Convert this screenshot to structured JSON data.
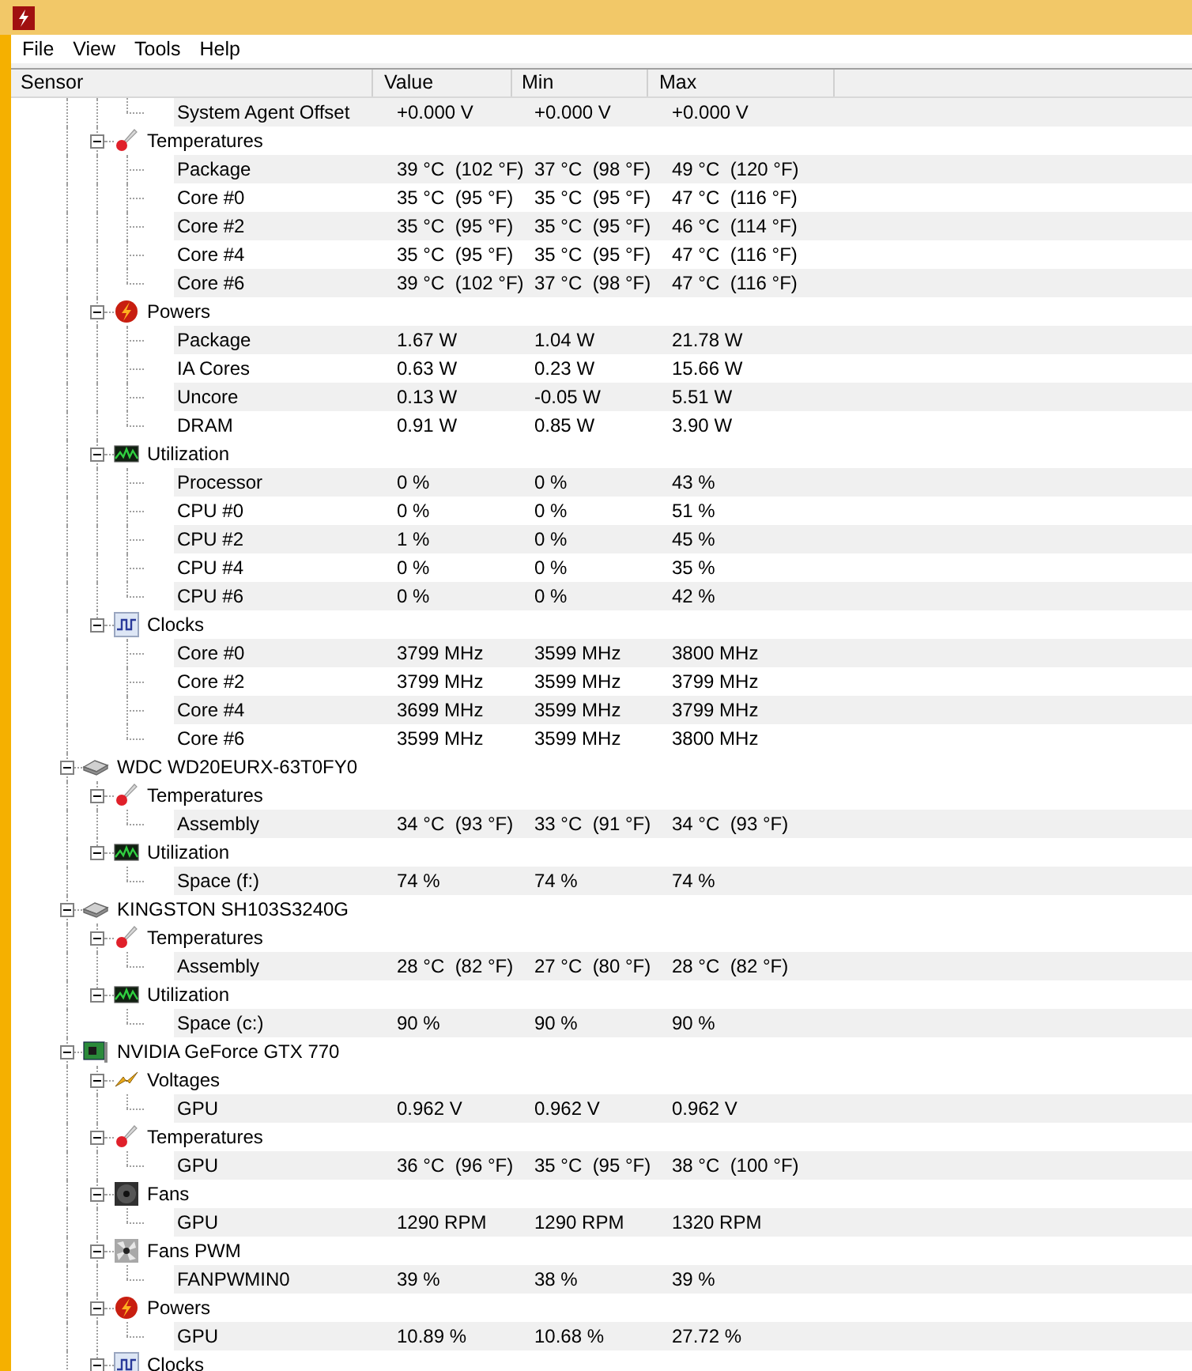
{
  "menu": [
    "File",
    "View",
    "Tools",
    "Help"
  ],
  "columns": [
    "Sensor",
    "Value",
    "Min",
    "Max"
  ],
  "tree": [
    {
      "children": [
        {
          "children": [
            {
              "name": "System Agent Offset",
              "value": "+0.000 V",
              "min": "+0.000 V",
              "max": "+0.000 V"
            }
          ]
        },
        {
          "kind": "temperatures",
          "name": "Temperatures",
          "expanded": true,
          "children": [
            {
              "name": "Package",
              "value": "39 °C  (102 °F)",
              "min": "37 °C  (98 °F)",
              "max": "49 °C  (120 °F)"
            },
            {
              "name": "Core #0",
              "value": "35 °C  (95 °F)",
              "min": "35 °C  (95 °F)",
              "max": "47 °C  (116 °F)"
            },
            {
              "name": "Core #2",
              "value": "35 °C  (95 °F)",
              "min": "35 °C  (95 °F)",
              "max": "46 °C  (114 °F)"
            },
            {
              "name": "Core #4",
              "value": "35 °C  (95 °F)",
              "min": "35 °C  (95 °F)",
              "max": "47 °C  (116 °F)"
            },
            {
              "name": "Core #6",
              "value": "39 °C  (102 °F)",
              "min": "37 °C  (98 °F)",
              "max": "47 °C  (116 °F)"
            }
          ]
        },
        {
          "kind": "powers",
          "name": "Powers",
          "expanded": true,
          "children": [
            {
              "name": "Package",
              "value": "1.67 W",
              "min": "1.04 W",
              "max": "21.78 W"
            },
            {
              "name": "IA Cores",
              "value": "0.63 W",
              "min": "0.23 W",
              "max": "15.66 W"
            },
            {
              "name": "Uncore",
              "value": "0.13 W",
              "min": "-0.05 W",
              "max": "5.51 W"
            },
            {
              "name": "DRAM",
              "value": "0.91 W",
              "min": "0.85 W",
              "max": "3.90 W"
            }
          ]
        },
        {
          "kind": "utilization",
          "name": "Utilization",
          "expanded": true,
          "children": [
            {
              "name": "Processor",
              "value": "0 %",
              "min": "0 %",
              "max": "43 %"
            },
            {
              "name": "CPU #0",
              "value": "0 %",
              "min": "0 %",
              "max": "51 %"
            },
            {
              "name": "CPU #2",
              "value": "1 %",
              "min": "0 %",
              "max": "45 %"
            },
            {
              "name": "CPU #4",
              "value": "0 %",
              "min": "0 %",
              "max": "35 %"
            },
            {
              "name": "CPU #6",
              "value": "0 %",
              "min": "0 %",
              "max": "42 %"
            }
          ]
        },
        {
          "kind": "clocks",
          "name": "Clocks",
          "expanded": true,
          "children": [
            {
              "name": "Core #0",
              "value": "3799 MHz",
              "min": "3599 MHz",
              "max": "3800 MHz"
            },
            {
              "name": "Core #2",
              "value": "3799 MHz",
              "min": "3599 MHz",
              "max": "3799 MHz"
            },
            {
              "name": "Core #4",
              "value": "3699 MHz",
              "min": "3599 MHz",
              "max": "3799 MHz"
            },
            {
              "name": "Core #6",
              "value": "3599 MHz",
              "min": "3599 MHz",
              "max": "3800 MHz"
            }
          ]
        }
      ]
    },
    {
      "kind": "drive",
      "name": "WDC WD20EURX-63T0FY0",
      "expanded": true,
      "children": [
        {
          "kind": "temperatures",
          "name": "Temperatures",
          "expanded": true,
          "children": [
            {
              "name": "Assembly",
              "value": "34 °C  (93 °F)",
              "min": "33 °C  (91 °F)",
              "max": "34 °C  (93 °F)"
            }
          ]
        },
        {
          "kind": "utilization",
          "name": "Utilization",
          "expanded": true,
          "children": [
            {
              "name": "Space (f:)",
              "value": "74 %",
              "min": "74 %",
              "max": "74 %"
            }
          ]
        }
      ]
    },
    {
      "kind": "drive",
      "name": "KINGSTON SH103S3240G",
      "expanded": true,
      "children": [
        {
          "kind": "temperatures",
          "name": "Temperatures",
          "expanded": true,
          "children": [
            {
              "name": "Assembly",
              "value": "28 °C  (82 °F)",
              "min": "27 °C  (80 °F)",
              "max": "28 °C  (82 °F)"
            }
          ]
        },
        {
          "kind": "utilization",
          "name": "Utilization",
          "expanded": true,
          "children": [
            {
              "name": "Space (c:)",
              "value": "90 %",
              "min": "90 %",
              "max": "90 %"
            }
          ]
        }
      ]
    },
    {
      "kind": "gpu",
      "name": "NVIDIA GeForce GTX 770",
      "expanded": true,
      "children": [
        {
          "kind": "voltages",
          "name": "Voltages",
          "expanded": true,
          "children": [
            {
              "name": "GPU",
              "value": "0.962 V",
              "min": "0.962 V",
              "max": "0.962 V"
            }
          ]
        },
        {
          "kind": "temperatures",
          "name": "Temperatures",
          "expanded": true,
          "children": [
            {
              "name": "GPU",
              "value": "36 °C  (96 °F)",
              "min": "35 °C  (95 °F)",
              "max": "38 °C  (100 °F)"
            }
          ]
        },
        {
          "kind": "fans",
          "name": "Fans",
          "expanded": true,
          "children": [
            {
              "name": "GPU",
              "value": "1290 RPM",
              "min": "1290 RPM",
              "max": "1320 RPM"
            }
          ]
        },
        {
          "kind": "fans_pwm",
          "name": "Fans PWM",
          "expanded": true,
          "children": [
            {
              "name": "FANPWMIN0",
              "value": "39 %",
              "min": "38 %",
              "max": "39 %"
            }
          ]
        },
        {
          "kind": "powers",
          "name": "Powers",
          "expanded": true,
          "children": [
            {
              "name": "GPU",
              "value": "10.89 %",
              "min": "10.68 %",
              "max": "27.72 %"
            }
          ]
        },
        {
          "kind": "clocks",
          "name": "Clocks",
          "expanded": true
        }
      ]
    }
  ]
}
